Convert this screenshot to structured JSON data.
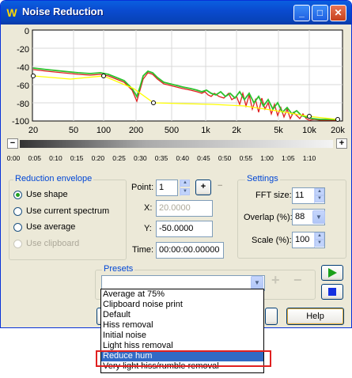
{
  "window": {
    "title": "Noise Reduction",
    "icon": "waveform-app-icon"
  },
  "titlebar_buttons": {
    "minimize": "_",
    "maximize": "□",
    "close": "✕"
  },
  "graph": {
    "y_ticks": [
      "0",
      "-20",
      "-40",
      "-60",
      "-80",
      "-100"
    ],
    "x_ticks": [
      "20",
      "50",
      "100",
      "200",
      "500",
      "1k",
      "2k",
      "5k",
      "10k",
      "20k"
    ]
  },
  "slider": {
    "minus": "−",
    "plus": "+",
    "ticks": [
      "0:00",
      "0:05",
      "0:10",
      "0:15",
      "0:20",
      "0:25",
      "0:30",
      "0:35",
      "0:40",
      "0:45",
      "0:50",
      "0:55",
      "1:00",
      "1:05",
      "1:10"
    ]
  },
  "reduction_envelope": {
    "title": "Reduction envelope",
    "options": [
      {
        "label": "Use shape",
        "selected": true,
        "disabled": false
      },
      {
        "label": "Use current spectrum",
        "selected": false,
        "disabled": false
      },
      {
        "label": "Use average",
        "selected": false,
        "disabled": false
      },
      {
        "label": "Use clipboard",
        "selected": false,
        "disabled": true
      }
    ]
  },
  "point_editor": {
    "point_label": "Point:",
    "point_value": "1",
    "x_label": "X:",
    "x_value": "20.0000",
    "y_label": "Y:",
    "y_value": "-50.0000",
    "time_label": "Time:",
    "time_value": "00:00:00.00000"
  },
  "settings": {
    "title": "Settings",
    "fft_label": "FFT size:",
    "fft_value": "11",
    "overlap_label": "Overlap (%):",
    "overlap_value": "88",
    "scale_label": "Scale (%):",
    "scale_value": "100"
  },
  "presets": {
    "title": "Presets",
    "selected": "",
    "options": [
      "Average at 75%",
      "Clipboard noise print",
      "Default",
      "Hiss removal",
      "Initial noise",
      "Light hiss removal",
      "Reduce hum",
      "Very light hiss/rumble removal"
    ],
    "highlighted": "Reduce hum"
  },
  "buttons": {
    "help": "Help"
  },
  "colors": {
    "title_bar": "#0a4bd0",
    "curve_yellow": "#ffff00",
    "curve_green": "#2bc12b",
    "curve_red": "#e02020",
    "play": "#1aa01a",
    "stop": "#1430e0"
  }
}
